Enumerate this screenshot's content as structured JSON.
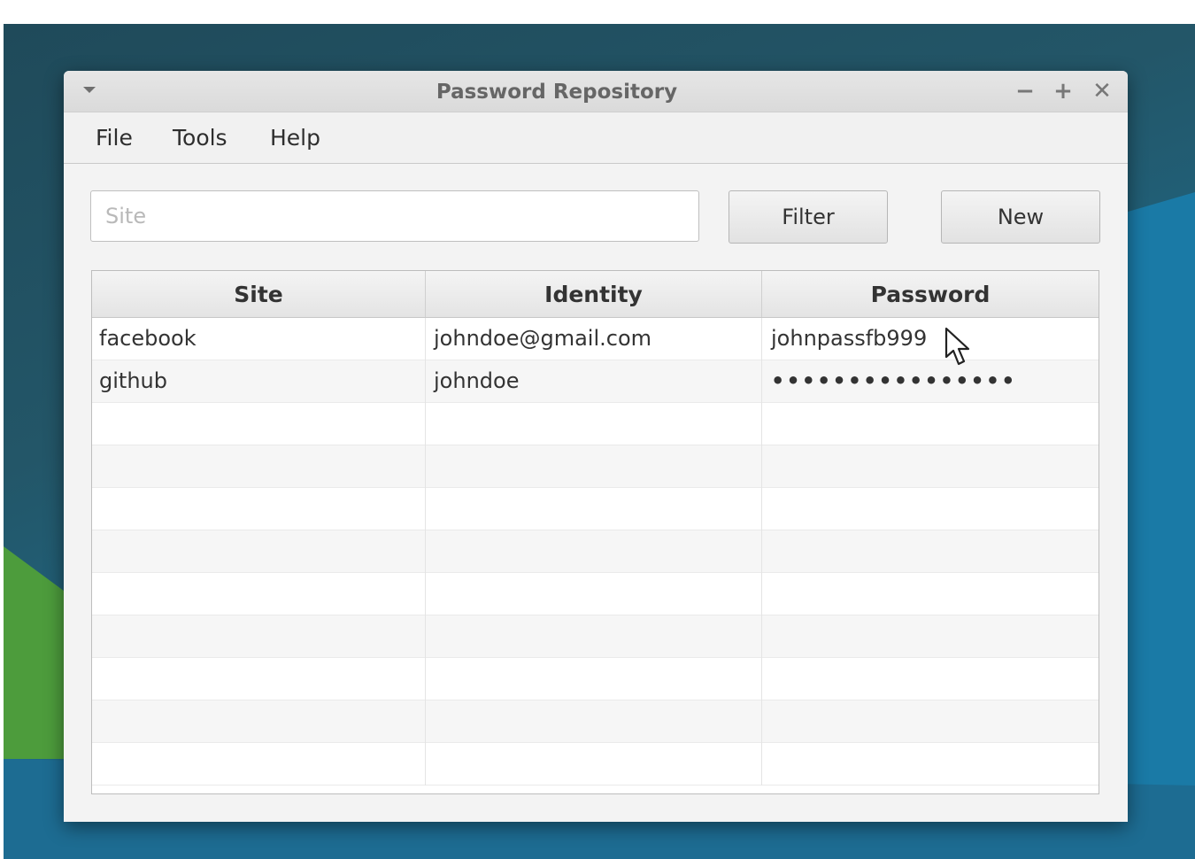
{
  "window": {
    "title": "Password Repository",
    "minimize_glyph": "−",
    "maximize_glyph": "+",
    "close_glyph": "✕"
  },
  "menubar": {
    "items": [
      "File",
      "Tools",
      "Help"
    ]
  },
  "toolbar": {
    "search_placeholder": "Site",
    "search_value": "",
    "filter_label": "Filter",
    "new_label": "New"
  },
  "table": {
    "columns": [
      "Site",
      "Identity",
      "Password"
    ],
    "rows": [
      {
        "site": "facebook",
        "identity": "johndoe@gmail.com",
        "password": "johnpassfb999"
      },
      {
        "site": "github",
        "identity": "johndoe",
        "password": "••••••••••••••••"
      }
    ]
  },
  "colors": {
    "window_bg": "#f3f3f3",
    "titlebar": "#dedede",
    "desktop": "#1f5568",
    "accent_green": "#4c9a3a"
  },
  "icons": {
    "window_menu": "dropdown-arrow-icon",
    "cursor": "mouse-pointer-icon"
  }
}
